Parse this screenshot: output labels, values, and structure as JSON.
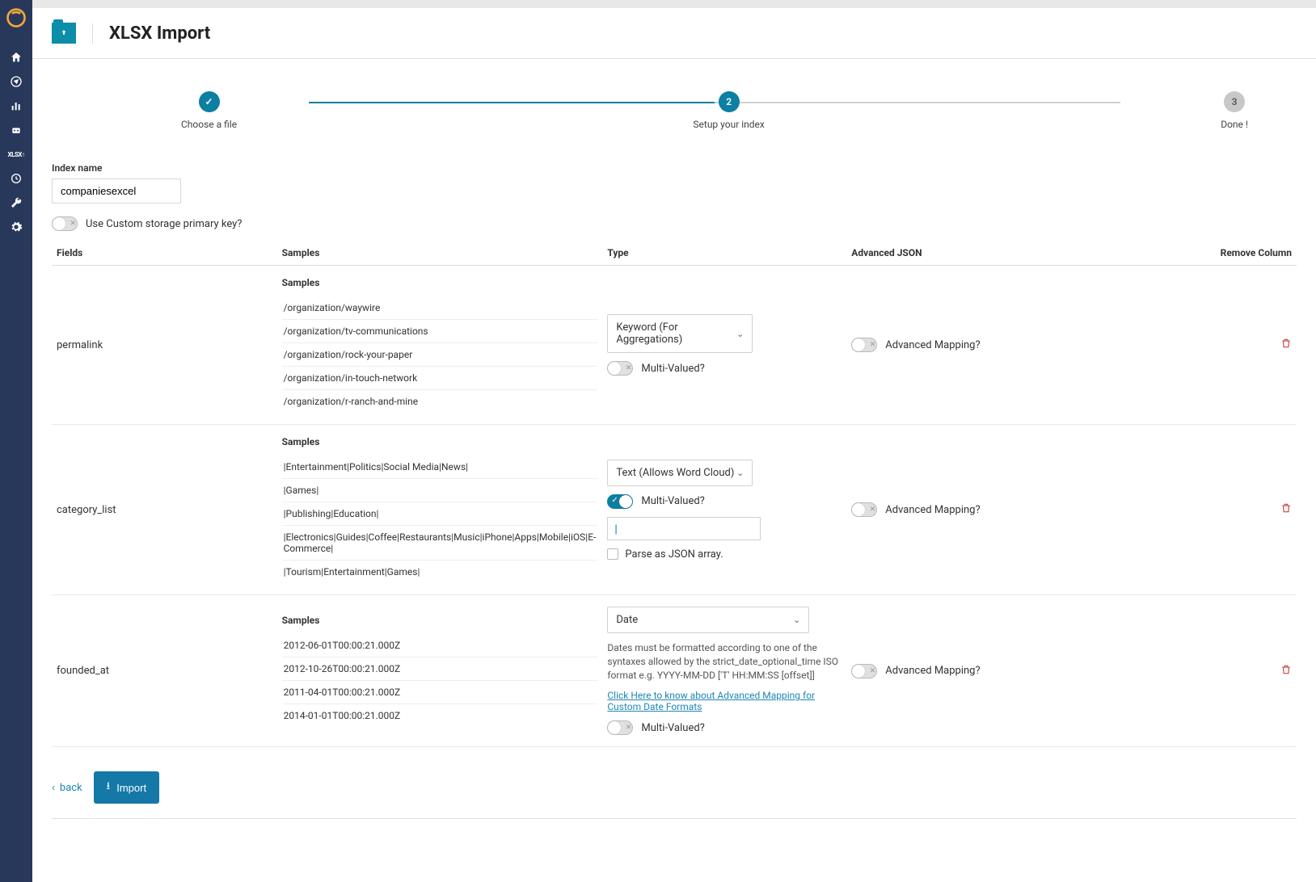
{
  "header": {
    "title": "XLSX Import"
  },
  "stepper": {
    "steps": [
      {
        "label": "Choose a file",
        "badge": "✓"
      },
      {
        "label": "Setup your index",
        "badge": "2"
      },
      {
        "label": "Done !",
        "badge": "3"
      }
    ]
  },
  "form": {
    "index_name_label": "Index name",
    "index_name_value": "companiesexcel",
    "custom_pk_label": "Use Custom storage primary key?"
  },
  "columns": {
    "fields": "Fields",
    "samples": "Samples",
    "type": "Type",
    "advanced": "Advanced JSON",
    "remove": "Remove Column"
  },
  "labels": {
    "samples_heading": "Samples",
    "multi_valued": "Multi-Valued?",
    "advanced_mapping": "Advanced Mapping?",
    "parse_json_array": "Parse as JSON array.",
    "separator_value": "|",
    "date_hint": "Dates must be formatted according to one of the syntaxes allowed by the strict_date_optional_time ISO format e.g. YYYY-MM-DD ['T' HH:MM:SS [offset]]",
    "date_link": "Click Here to know about Advanced Mapping for Custom Date Formats"
  },
  "type_options": {
    "keyword": "Keyword (For Aggregations)",
    "text": "Text (Allows Word Cloud)",
    "date": "Date"
  },
  "rows": [
    {
      "field": "permalink",
      "samples": [
        "/organization/waywire",
        "/organization/tv-communications",
        "/organization/rock-your-paper",
        "/organization/in-touch-network",
        "/organization/r-ranch-and-mine"
      ],
      "type_key": "keyword",
      "multi_on": false,
      "show_sep": false,
      "show_date_hint": false
    },
    {
      "field": "category_list",
      "samples": [
        "|Entertainment|Politics|Social Media|News|",
        "|Games|",
        "|Publishing|Education|",
        "|Electronics|Guides|Coffee|Restaurants|Music|iPhone|Apps|Mobile|iOS|E-Commerce|",
        "|Tourism|Entertainment|Games|"
      ],
      "type_key": "text",
      "multi_on": true,
      "show_sep": true,
      "show_date_hint": false
    },
    {
      "field": "founded_at",
      "samples": [
        "2012-06-01T00:00:21.000Z",
        "2012-10-26T00:00:21.000Z",
        "2011-04-01T00:00:21.000Z",
        "2014-01-01T00:00:21.000Z"
      ],
      "type_key": "date",
      "multi_on": false,
      "show_sep": false,
      "show_date_hint": true
    }
  ],
  "footer": {
    "back": "back",
    "import": "Import"
  }
}
